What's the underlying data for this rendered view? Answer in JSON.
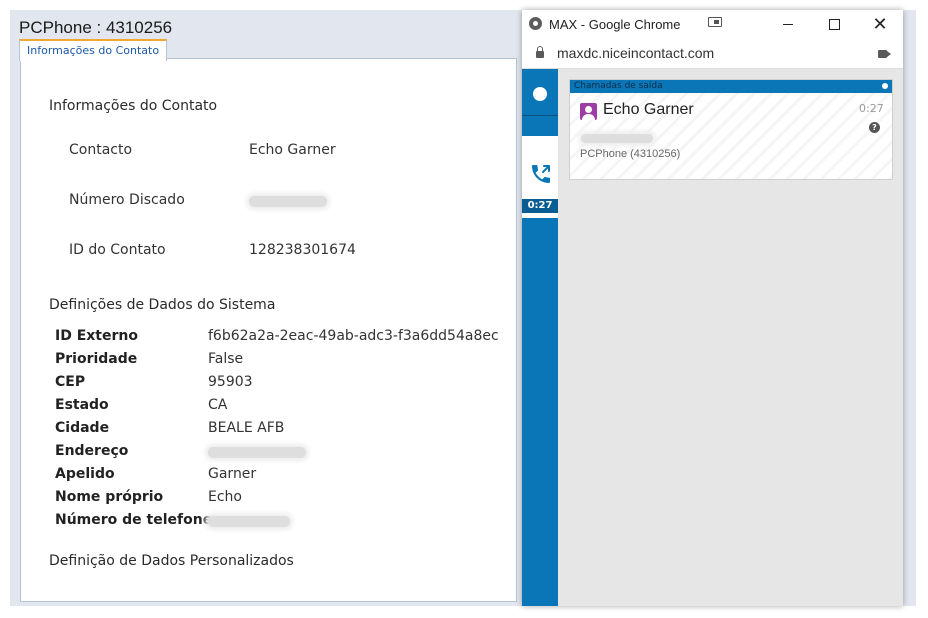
{
  "main_window": {
    "title": "PCPhone : 4310256",
    "tab_label": "Informações do Contato"
  },
  "contact_info": {
    "section_title": "Informações do Contato",
    "rows": [
      {
        "label": "Contacto",
        "value": "Echo Garner",
        "redacted": false
      },
      {
        "label": "Número Discado",
        "value": "",
        "redacted": true
      },
      {
        "label": "ID do Contato",
        "value": "128238301674",
        "redacted": false
      }
    ]
  },
  "system_data": {
    "section_title": "Definições de Dados do Sistema",
    "rows": [
      {
        "label": "ID Externo",
        "value": "f6b62a2a-2eac-49ab-adc3-f3a6dd54a8ec",
        "redacted": false
      },
      {
        "label": "Prioridade",
        "value": "False",
        "redacted": false
      },
      {
        "label": "CEP",
        "value": "95903",
        "redacted": false
      },
      {
        "label": "Estado",
        "value": "CA",
        "redacted": false
      },
      {
        "label": "Cidade",
        "value": "BEALE AFB",
        "redacted": false
      },
      {
        "label": "Endereço",
        "value": "",
        "redacted": true
      },
      {
        "label": "Apelido",
        "value": "Garner",
        "redacted": false
      },
      {
        "label": "Nome próprio",
        "value": "Echo",
        "redacted": false
      },
      {
        "label": "Número de telefone",
        "value": "",
        "redacted": true
      }
    ]
  },
  "custom_data": {
    "section_title": "Definição de Dados Personalizados"
  },
  "chrome_window": {
    "title": "MAX - Google Chrome",
    "url": "maxdc.niceincontact.com"
  },
  "max_app": {
    "sidebar": {
      "call_timer": "0:27"
    },
    "outbound_card": {
      "header": "Chamadas de saída",
      "contact_name": "Echo Garner",
      "elapsed": "0:27",
      "skill": "PCPhone (4310256)",
      "help_glyph": "?"
    }
  },
  "colors": {
    "max_blue": "#0a76b7",
    "avatar_purple": "#9c3da4",
    "tab_accent": "#f0a830"
  },
  "icons": [
    "globe-icon",
    "cast-icon",
    "lock-icon",
    "camera-icon",
    "phone-outbound-icon",
    "contact-avatar-icon",
    "help-icon",
    "status-dot-icon"
  ]
}
